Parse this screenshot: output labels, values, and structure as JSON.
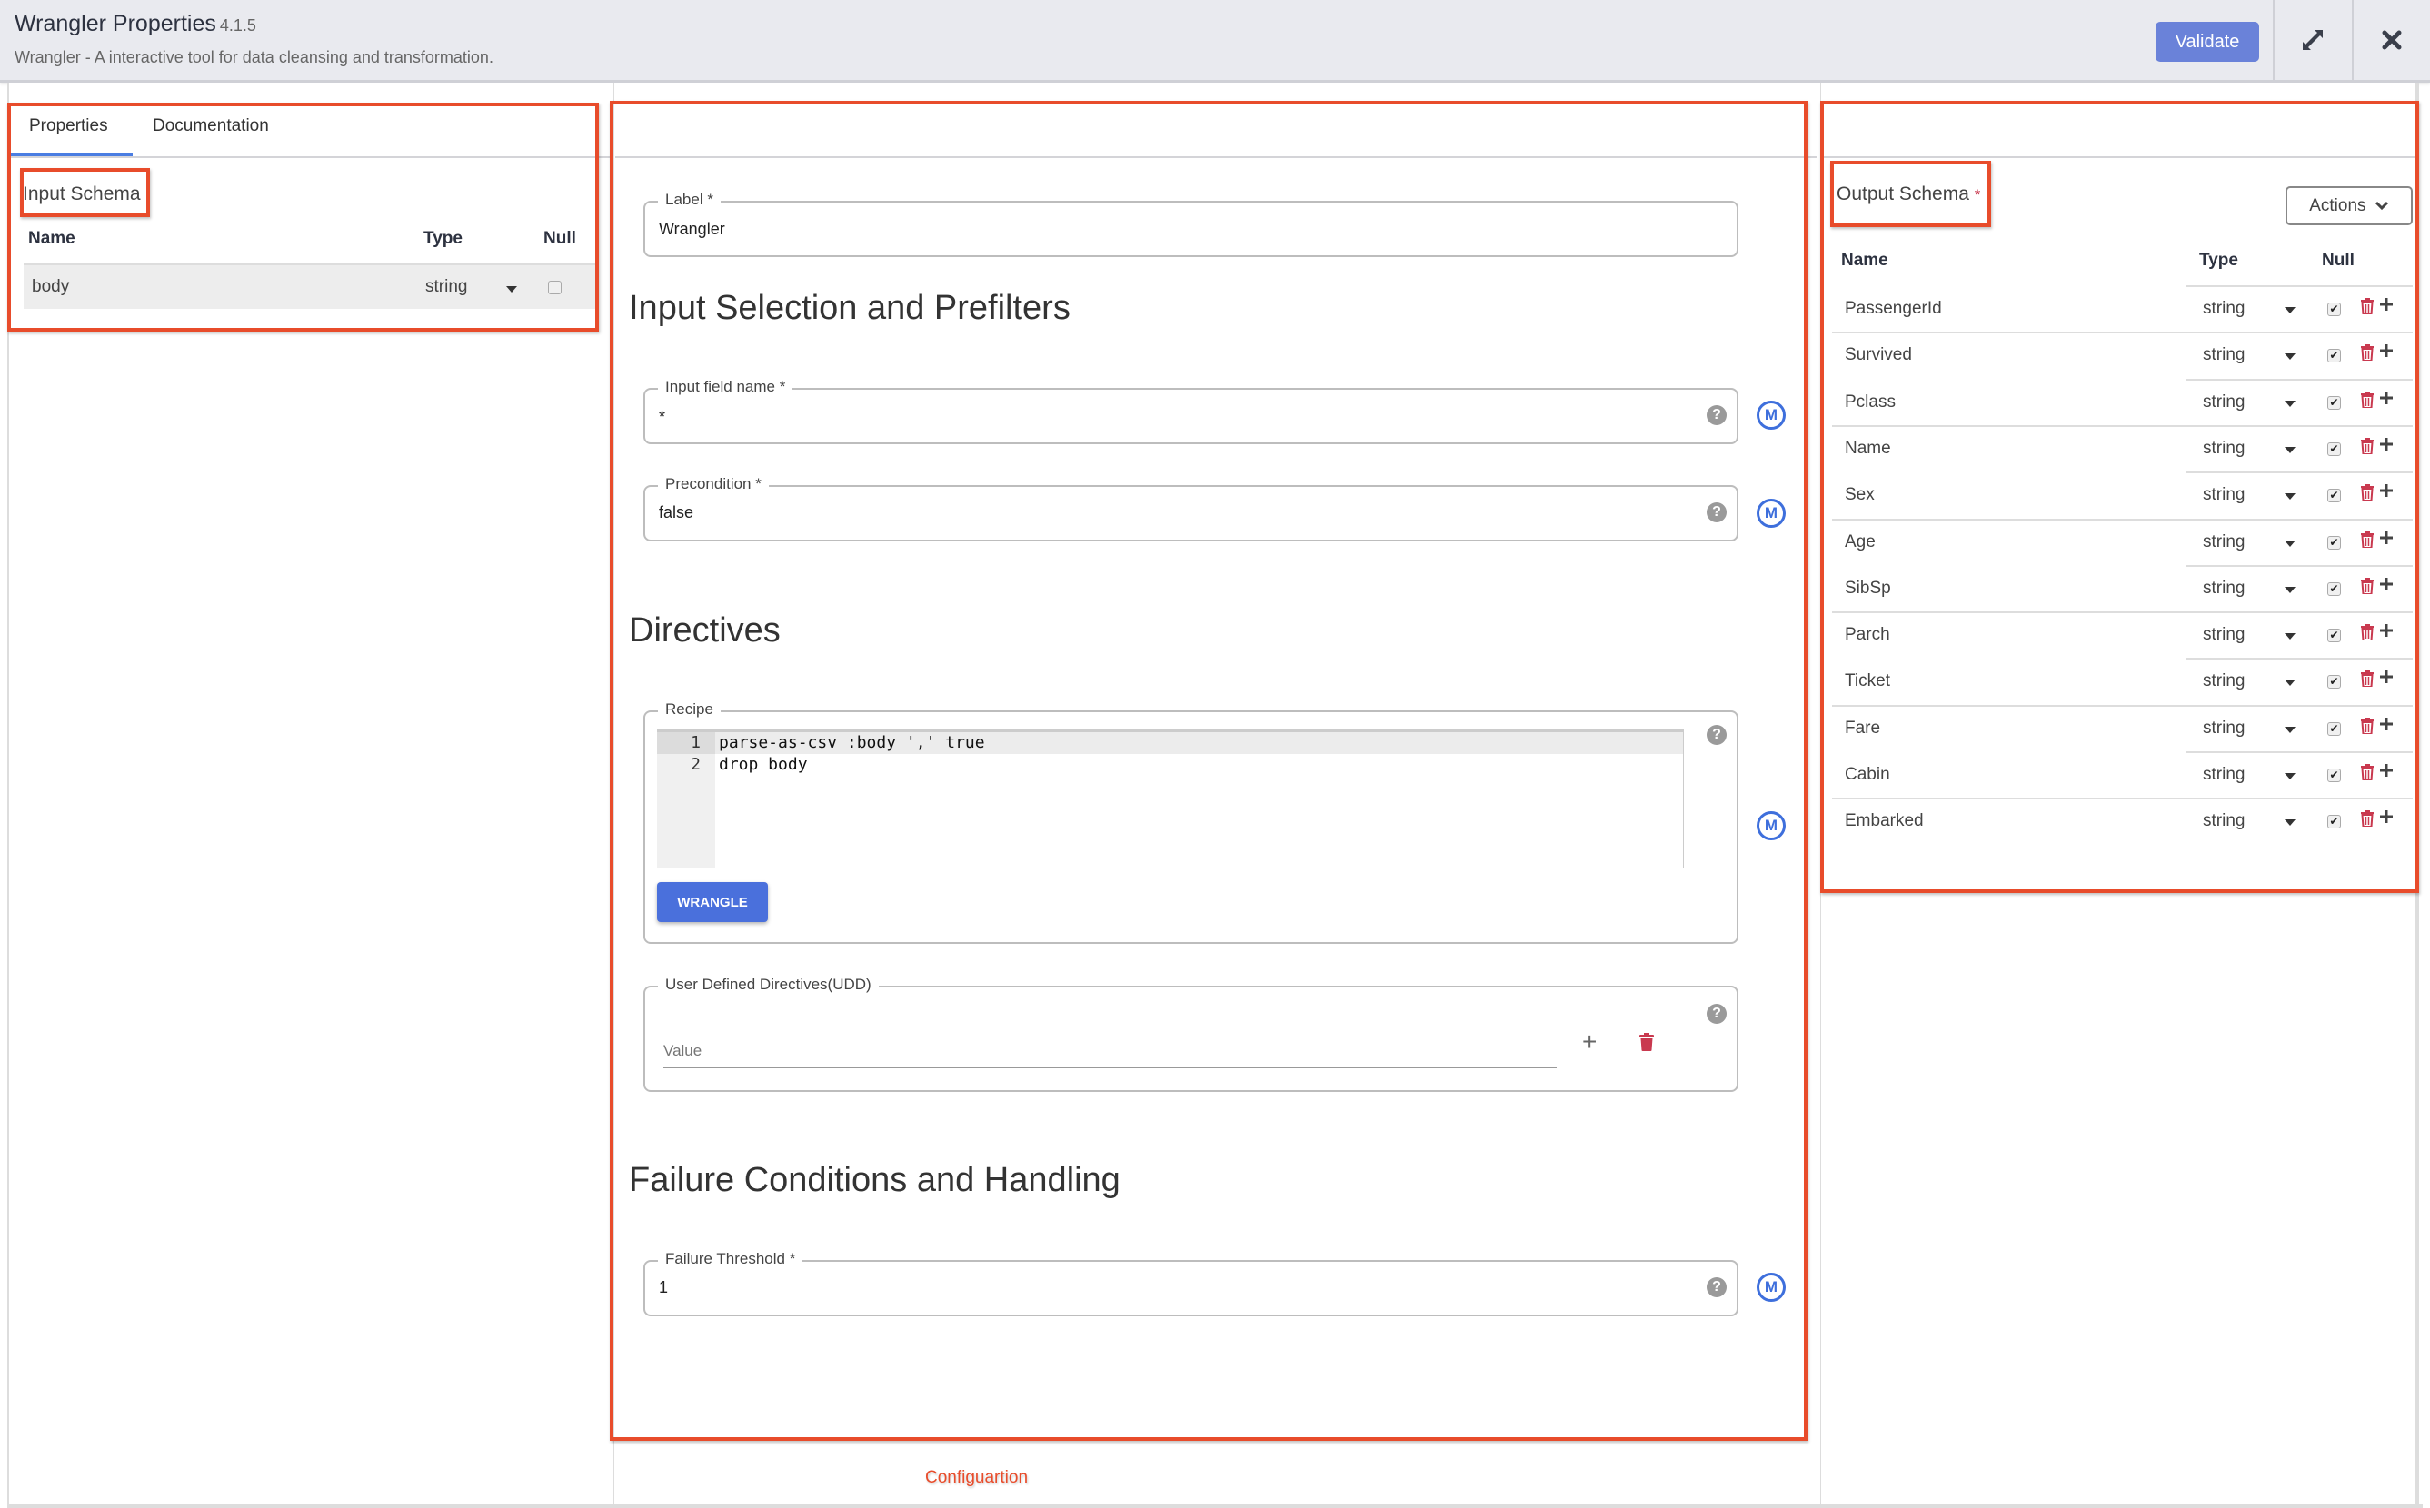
{
  "header": {
    "title": "Wrangler Properties",
    "version": "4.1.5",
    "subtitle": "Wrangler - A interactive tool for data cleansing and transformation.",
    "validate_label": "Validate",
    "expand_icon": "expand-arrows-icon",
    "close_icon": "close-x-icon"
  },
  "left_panel": {
    "tabs": [
      {
        "label": "Properties",
        "active": true
      },
      {
        "label": "Documentation",
        "active": false
      }
    ],
    "input_schema": {
      "title": "Input Schema",
      "columns": [
        "Name",
        "Type",
        "Null"
      ],
      "rows": [
        {
          "name": "body",
          "type": "string",
          "nullable": false
        }
      ]
    }
  },
  "config": {
    "label_field": {
      "label": "Label",
      "required_mark": "*",
      "value": "Wrangler"
    },
    "section_input": "Input Selection and Prefilters",
    "input_field_name": {
      "label": "Input field name",
      "required_mark": "*",
      "value": "*"
    },
    "precondition": {
      "label": "Precondition",
      "required_mark": "*",
      "value": "false"
    },
    "section_directives": "Directives",
    "recipe": {
      "label": "Recipe",
      "lines": [
        {
          "num": "1",
          "text": "parse-as-csv :body ',' true"
        },
        {
          "num": "2",
          "text": "drop body"
        }
      ],
      "wrangle_label": "WRANGLE"
    },
    "udd": {
      "label": "User Defined Directives(UDD)",
      "placeholder": "Value",
      "add_label": "+"
    },
    "section_failure": "Failure Conditions and Handling",
    "failure_threshold": {
      "label": "Failure Threshold",
      "required_mark": "*",
      "value": "1"
    },
    "help_glyph": "?",
    "macro_glyph": "M",
    "footer_annotation": "Configuartion"
  },
  "output_schema": {
    "title": "Output Schema",
    "required_mark": "*",
    "actions_label": "Actions",
    "columns": [
      "Name",
      "Type",
      "Null"
    ],
    "rows": [
      {
        "name": "PassengerId",
        "type": "string",
        "nullable": true
      },
      {
        "name": "Survived",
        "type": "string",
        "nullable": true
      },
      {
        "name": "Pclass",
        "type": "string",
        "nullable": true
      },
      {
        "name": "Name",
        "type": "string",
        "nullable": true
      },
      {
        "name": "Sex",
        "type": "string",
        "nullable": true
      },
      {
        "name": "Age",
        "type": "string",
        "nullable": true
      },
      {
        "name": "SibSp",
        "type": "string",
        "nullable": true
      },
      {
        "name": "Parch",
        "type": "string",
        "nullable": true
      },
      {
        "name": "Ticket",
        "type": "string",
        "nullable": true
      },
      {
        "name": "Fare",
        "type": "string",
        "nullable": true
      },
      {
        "name": "Cabin",
        "type": "string",
        "nullable": true
      },
      {
        "name": "Embarked",
        "type": "string",
        "nullable": true
      }
    ]
  },
  "colors": {
    "accent": "#4a70dc",
    "validate": "#6a82d9",
    "annotation": "#e84c2b",
    "delete": "#c9394f",
    "header_bg": "#e9eaef"
  }
}
